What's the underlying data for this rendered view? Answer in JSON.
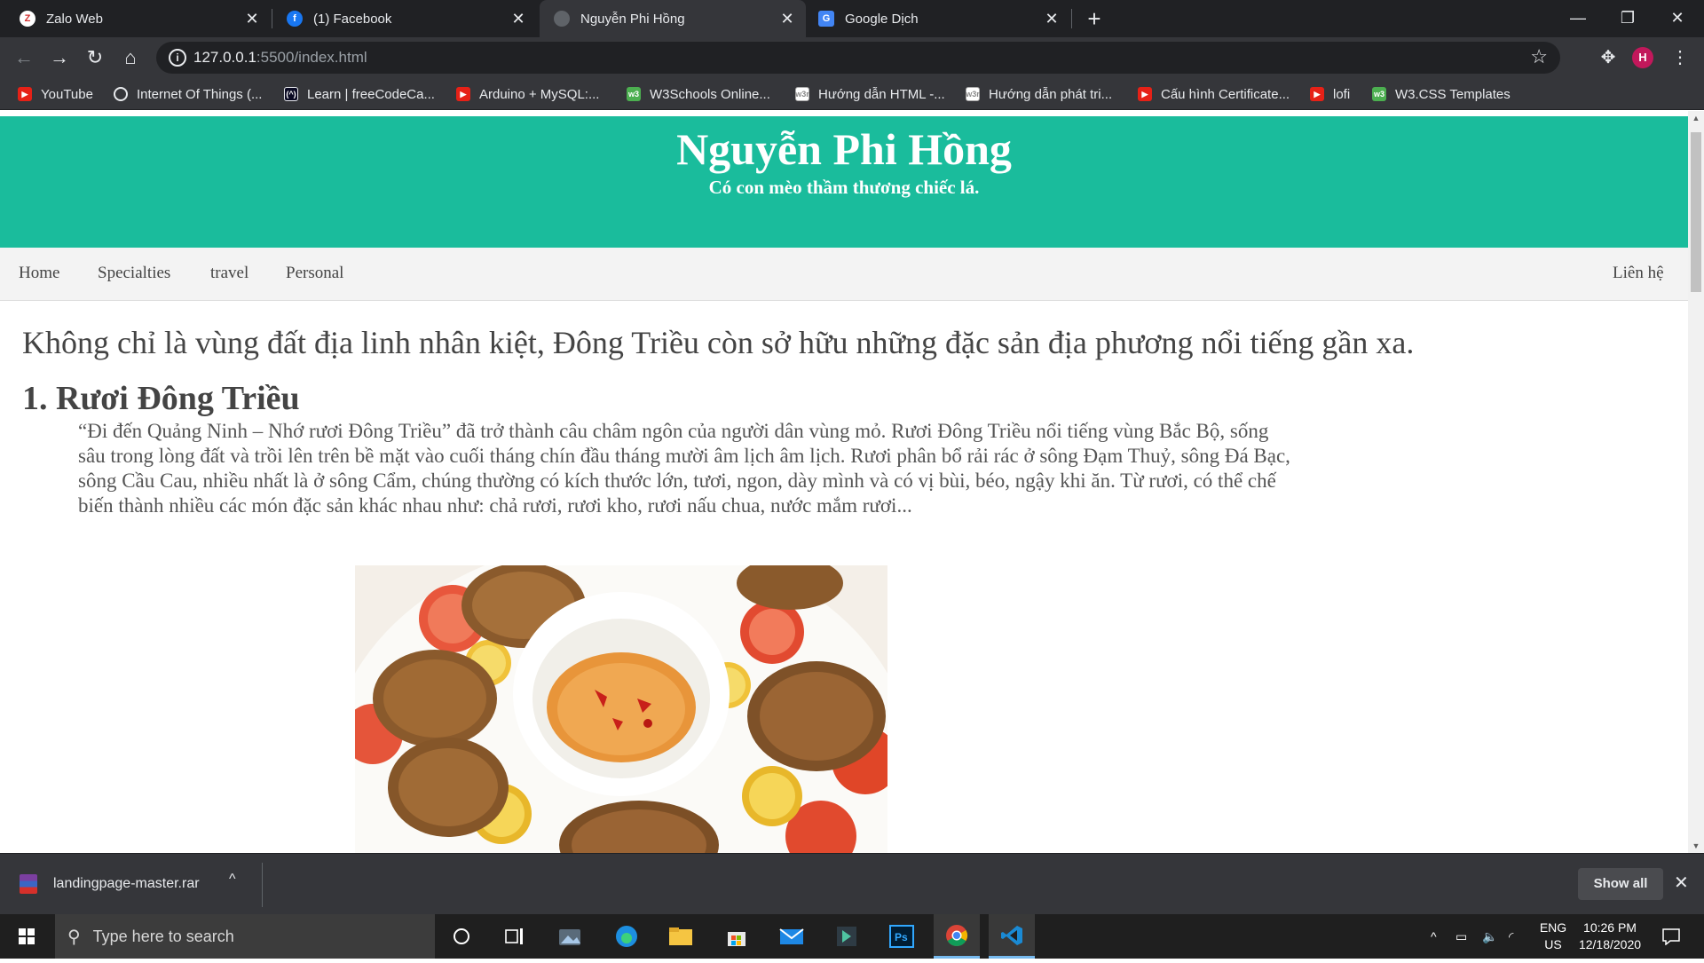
{
  "tabs": [
    {
      "title": "Zalo Web",
      "icon": "zalo-icon"
    },
    {
      "title": "(1) Facebook",
      "icon": "facebook-icon"
    },
    {
      "title": "Nguyễn Phi Hồng",
      "icon": "globe-icon",
      "active": true
    },
    {
      "title": "Google Dịch",
      "icon": "google-translate-icon"
    }
  ],
  "address_bar": {
    "host": "127.0.0.1",
    "rest": ":5500/index.html"
  },
  "profile_initial": "H",
  "bookmarks": [
    {
      "label": "YouTube",
      "icon": "youtube-icon"
    },
    {
      "label": "Internet Of Things (...",
      "icon": "globe-icon"
    },
    {
      "label": "Learn | freeCodeCa...",
      "icon": "freecodecamp-icon"
    },
    {
      "label": "Arduino + MySQL:...",
      "icon": "youtube-icon"
    },
    {
      "label": "W3Schools Online...",
      "icon": "w3schools-icon"
    },
    {
      "label": "Hướng dẫn HTML -...",
      "icon": "w3r-icon"
    },
    {
      "label": "Hướng dẫn phát tri...",
      "icon": "w3r-icon"
    },
    {
      "label": "Cấu hình Certificate...",
      "icon": "youtube-icon"
    },
    {
      "label": "lofi",
      "icon": "youtube-icon"
    },
    {
      "label": "W3.CSS Templates",
      "icon": "w3schools-icon"
    }
  ],
  "page": {
    "hero_title": "Nguyễn Phi Hồng",
    "hero_subtitle": "Có con mèo thầm thương chiếc lá.",
    "nav": [
      "Home",
      "Specialties",
      "travel",
      "Personal"
    ],
    "nav_right": "Liên hệ",
    "lead": "Không chỉ là vùng đất địa linh nhân kiệt, Đông Triều còn sở hữu những đặc sản địa phương nổi tiếng gần xa.",
    "section_heading": "1. Rươi Đông Triều",
    "section_paragraph": "“Đi đến Quảng Ninh – Nhớ rươi Đông Triều” đã trở thành câu châm ngôn của người dân vùng mỏ. Rươi Đông Triều nổi tiếng vùng Bắc Bộ, sống sâu trong lòng đất và trồi lên trên bề mặt vào cuối tháng chín đầu tháng mười âm lịch âm lịch. Rươi phân bổ rải rác ở sông Đạm Thuỷ, sông Đá Bạc, sông Cầu Cau, nhiều nhất là ở sông Cẩm, chúng thường có kích thước lớn, tươi, ngon, dày mình và có vị bùi, béo, ngậy khi ăn. Từ rươi, có thể chế biến thành nhiều các món đặc sản khác nhau như: chả rươi, rươi kho, rươi nấu chua, nước mắm rươi..."
  },
  "downloads": {
    "file": "landingpage-master.rar",
    "show_all": "Show all"
  },
  "taskbar": {
    "search_placeholder": "Type here to search",
    "lang_top": "ENG",
    "lang_bottom": "US",
    "time": "10:26 PM",
    "date": "12/18/2020"
  },
  "colors": {
    "hero_bg": "#1abc9c",
    "chrome_dark": "#202124",
    "chrome_toolbar": "#35363a"
  }
}
